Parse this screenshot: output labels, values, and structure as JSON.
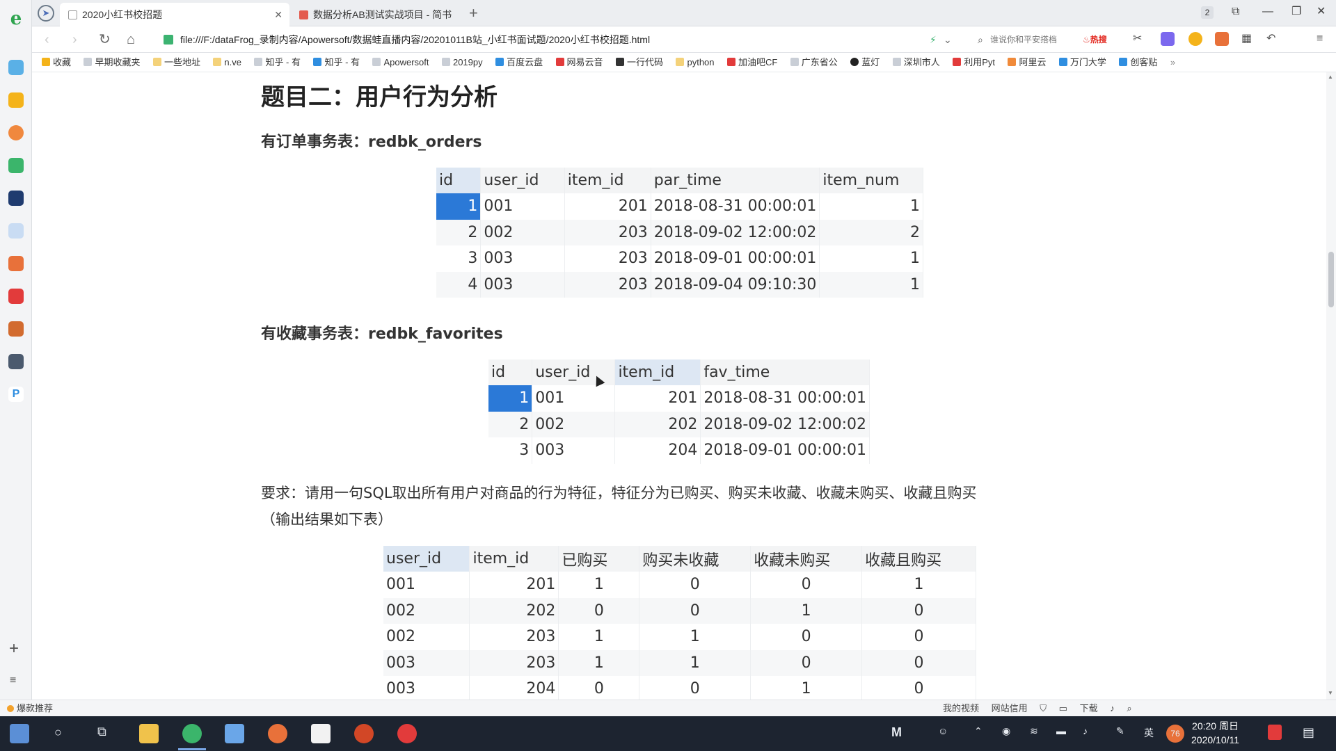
{
  "browser": {
    "tabs": [
      {
        "title": "2020小红书校招题",
        "active": true
      },
      {
        "title": "数据分析AB测试实战项目 - 简书",
        "active": false
      }
    ],
    "tab_count": "2",
    "url": "file:///F:/dataFrog_录制内容/Apowersoft/数据蛙直播内容/20201011B站_小红书面试题/2020小红书校招题.html",
    "search_placeholder": "谁说你和平安搭档",
    "hot_badge": "♨热搜",
    "bookmarks": [
      "收藏",
      "早期收藏夹",
      "一些地址",
      "n.ve",
      "知乎 - 有",
      "知乎 - 有",
      "Apowersoft",
      "2019py",
      "百度云盘",
      "网易云音",
      "一行代码",
      "python",
      "加油吧CF",
      "广东省公",
      "蓝灯",
      "深圳市人",
      "利用Pyt",
      "阿里云",
      "万门大学",
      "创客贴"
    ]
  },
  "page": {
    "title": "题目二：用户行为分析",
    "orders_heading": "有订单事务表：redbk_orders",
    "orders": {
      "columns": [
        "id",
        "user_id",
        "item_id",
        "par_time",
        "item_num"
      ],
      "rows": [
        [
          "1",
          "001",
          "201",
          "2018-08-31 00:00:01",
          "1"
        ],
        [
          "2",
          "002",
          "203",
          "2018-09-02 12:00:02",
          "2"
        ],
        [
          "3",
          "003",
          "203",
          "2018-09-01 00:00:01",
          "1"
        ],
        [
          "4",
          "003",
          "203",
          "2018-09-04 09:10:30",
          "1"
        ]
      ]
    },
    "favorites_heading": "有收藏事务表：redbk_favorites",
    "favorites": {
      "columns": [
        "id",
        "user_id",
        "item_id",
        "fav_time"
      ],
      "rows": [
        [
          "1",
          "001",
          "201",
          "2018-08-31 00:00:01"
        ],
        [
          "2",
          "002",
          "202",
          "2018-09-02 12:00:02"
        ],
        [
          "3",
          "003",
          "204",
          "2018-09-01 00:00:01"
        ]
      ]
    },
    "requirement_line1": "要求：请用一句SQL取出所有用户对商品的行为特征，特征分为已购买、购买未收藏、收藏未购买、收藏且购买",
    "requirement_line2": "（输出结果如下表）",
    "result": {
      "columns": [
        "user_id",
        "item_id",
        "已购买",
        "购买未收藏",
        "收藏未购买",
        "收藏且购买"
      ],
      "rows": [
        [
          "001",
          "201",
          "1",
          "0",
          "0",
          "1"
        ],
        [
          "002",
          "202",
          "0",
          "0",
          "1",
          "0"
        ],
        [
          "002",
          "203",
          "1",
          "1",
          "0",
          "0"
        ],
        [
          "003",
          "203",
          "1",
          "1",
          "0",
          "0"
        ],
        [
          "003",
          "204",
          "0",
          "0",
          "1",
          "0"
        ]
      ]
    }
  },
  "statusbar": {
    "left": "爆款推荐",
    "right": [
      "我的视频",
      "网站信用",
      "下载"
    ]
  },
  "taskbar": {
    "time": "20:20 周日",
    "date": "2020/10/11",
    "lang": "英",
    "temp": "76"
  },
  "colors": {
    "selection": "#2b79d7",
    "header_bg": "#f3f4f5",
    "taskbar": "#1d2430"
  }
}
